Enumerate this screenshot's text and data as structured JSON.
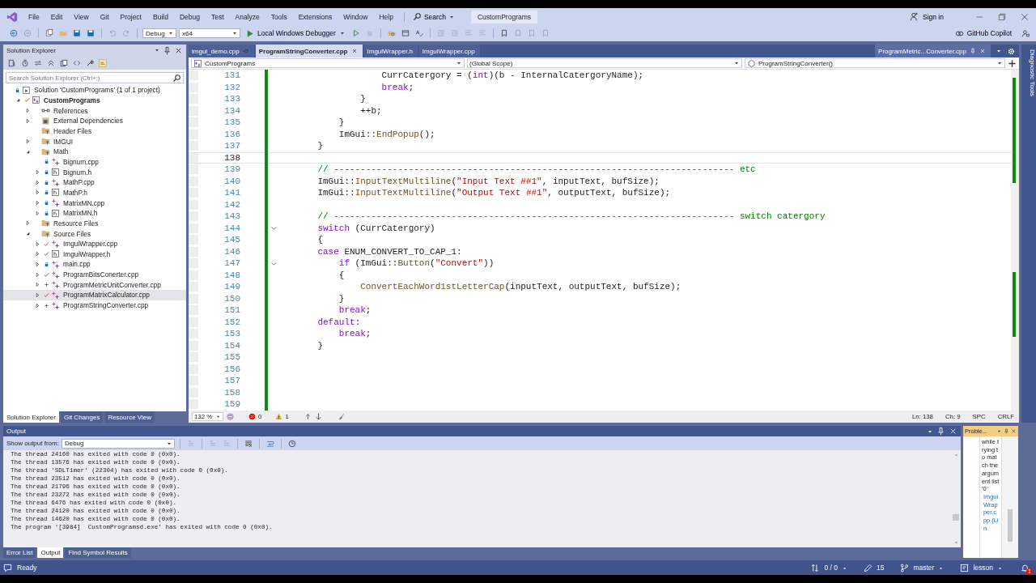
{
  "window": {
    "title": "CustomPrograms",
    "sign_in": "Sign in"
  },
  "menu": {
    "items": [
      "File",
      "Edit",
      "View",
      "Git",
      "Project",
      "Build",
      "Debug",
      "Test",
      "Analyze",
      "Tools",
      "Extensions",
      "Window",
      "Help"
    ],
    "search": "Search"
  },
  "toolbar": {
    "configuration": "Debug",
    "platform": "x64",
    "debugger": "Local Windows Debugger",
    "copilot": "GitHub Copilot"
  },
  "solution_explorer": {
    "title": "Solution Explorer",
    "search_placeholder": "Search Solution Explorer (Ctrl+;)",
    "tree": [
      {
        "label": "Solution 'CustomPrograms' (1 of 1 project)",
        "kind": "solution",
        "locked": true,
        "modified": false,
        "added": false,
        "selected": false,
        "children": [
          {
            "label": "CustomPrograms",
            "kind": "project",
            "expanded": true,
            "locked": false,
            "modified": true,
            "added": false,
            "selected": false,
            "children": [
              {
                "label": "References",
                "kind": "references",
                "expanded": false,
                "locked": false,
                "modified": false,
                "added": false,
                "selected": false
              },
              {
                "label": "External Dependencies",
                "kind": "dependencies",
                "expanded": false,
                "locked": false,
                "modified": false,
                "added": false,
                "selected": false
              },
              {
                "label": "Header Files",
                "kind": "filter",
                "locked": false,
                "modified": false,
                "added": false,
                "selected": false
              },
              {
                "label": "IMGUI",
                "kind": "filter",
                "expanded": false,
                "locked": false,
                "modified": false,
                "added": false,
                "selected": false
              },
              {
                "label": "Math",
                "kind": "filter",
                "expanded": true,
                "locked": false,
                "modified": false,
                "added": false,
                "selected": false,
                "children": [
                  {
                    "label": "Bignum.cpp",
                    "kind": "cpp",
                    "locked": true,
                    "modified": false,
                    "added": false,
                    "selected": false
                  },
                  {
                    "label": "Bignum.h",
                    "kind": "h",
                    "expanded": false,
                    "locked": true,
                    "modified": false,
                    "added": false,
                    "selected": false
                  },
                  {
                    "label": "MathP.cpp",
                    "kind": "cpp",
                    "expanded": false,
                    "locked": true,
                    "modified": false,
                    "added": false,
                    "selected": false
                  },
                  {
                    "label": "MathP.h",
                    "kind": "h",
                    "expanded": false,
                    "locked": true,
                    "modified": false,
                    "added": false,
                    "selected": false
                  },
                  {
                    "label": "MatrixMN.cpp",
                    "kind": "cpp",
                    "expanded": false,
                    "locked": true,
                    "modified": false,
                    "added": false,
                    "selected": false
                  },
                  {
                    "label": "MatrixMN.h",
                    "kind": "h",
                    "expanded": false,
                    "locked": true,
                    "modified": false,
                    "added": false,
                    "selected": false
                  }
                ]
              },
              {
                "label": "Resource Files",
                "kind": "filter",
                "expanded": false,
                "locked": false,
                "modified": false,
                "added": false,
                "selected": false
              },
              {
                "label": "Source Files",
                "kind": "filter",
                "expanded": true,
                "locked": false,
                "modified": false,
                "added": false,
                "selected": false,
                "children": [
                  {
                    "label": "ImguiWrapper.cpp",
                    "kind": "cpp",
                    "expanded": false,
                    "locked": false,
                    "modified": true,
                    "added": false,
                    "selected": false
                  },
                  {
                    "label": "ImguiWrapper.h",
                    "kind": "h",
                    "expanded": false,
                    "locked": false,
                    "modified": true,
                    "added": false,
                    "selected": false
                  },
                  {
                    "label": "main.cpp",
                    "kind": "cpp",
                    "expanded": false,
                    "locked": true,
                    "modified": false,
                    "added": false,
                    "selected": false
                  },
                  {
                    "label": "ProgramBitsConerter.cpp",
                    "kind": "cpp",
                    "expanded": false,
                    "locked": false,
                    "modified": true,
                    "added": false,
                    "selected": false
                  },
                  {
                    "label": "ProgramMetricUnitConverter.cpp",
                    "kind": "cpp",
                    "expanded": false,
                    "locked": false,
                    "modified": false,
                    "added": true,
                    "selected": false
                  },
                  {
                    "label": "ProgramMatrixCalculator.cpp",
                    "kind": "cpp",
                    "expanded": false,
                    "locked": false,
                    "modified": true,
                    "added": false,
                    "selected": true
                  },
                  {
                    "label": "ProgramStringConverter.cpp",
                    "kind": "cpp",
                    "expanded": false,
                    "locked": false,
                    "modified": false,
                    "added": true,
                    "selected": false
                  }
                ]
              }
            ]
          }
        ]
      }
    ],
    "tabs": [
      {
        "label": "Solution Explorer",
        "selected": true
      },
      {
        "label": "Git Changes",
        "selected": false
      },
      {
        "label": "Resource View",
        "selected": false
      }
    ]
  },
  "editor": {
    "tabs": [
      {
        "label": "imgui_demo.cpp",
        "selected": false,
        "pinned": true,
        "kind": "docked"
      },
      {
        "label": "ProgramStringConverter.cpp",
        "selected": true,
        "pinned": false,
        "kind": "docked"
      },
      {
        "label": "ImguiWrapper.h",
        "selected": false,
        "pinned": false,
        "kind": "docked"
      },
      {
        "label": "ImguiWrapper.cpp",
        "selected": false,
        "pinned": false,
        "kind": "docked"
      },
      {
        "label": "ProgramMetric...Converter.cpp",
        "selected": false,
        "pinned": true,
        "kind": "overflow"
      }
    ],
    "nav": {
      "project": "CustomPrograms",
      "scope": "(Global Scope)",
      "member": "ProgramStringConverter()"
    },
    "lines": [
      {
        "number": "131",
        "current": false,
        "foldable": false,
        "tokens": [
          {
            "text": "                CurrCatergory = (",
            "kind": "txt"
          },
          {
            "text": "int",
            "kind": "kw"
          },
          {
            "text": ")(b - InternalCatergoryName);",
            "kind": "txt"
          }
        ]
      },
      {
        "number": "132",
        "current": false,
        "foldable": false,
        "tokens": [
          {
            "text": "                break",
            "kind": "kw"
          },
          {
            "text": ";",
            "kind": "txt"
          }
        ]
      },
      {
        "number": "133",
        "current": false,
        "foldable": false,
        "tokens": [
          {
            "text": "            }",
            "kind": "txt"
          }
        ]
      },
      {
        "number": "134",
        "current": false,
        "foldable": false,
        "tokens": [
          {
            "text": "            ++b;",
            "kind": "txt"
          }
        ]
      },
      {
        "number": "135",
        "current": false,
        "foldable": false,
        "tokens": [
          {
            "text": "        }",
            "kind": "txt"
          }
        ]
      },
      {
        "number": "136",
        "current": false,
        "foldable": false,
        "tokens": [
          {
            "text": "        ImGui::",
            "kind": "txt"
          },
          {
            "text": "EndPopup",
            "kind": "fn"
          },
          {
            "text": "();",
            "kind": "txt"
          }
        ]
      },
      {
        "number": "137",
        "current": false,
        "foldable": false,
        "tokens": [
          {
            "text": "    }",
            "kind": "txt"
          }
        ]
      },
      {
        "number": "138",
        "current": true,
        "foldable": false
      },
      {
        "number": "139",
        "current": false,
        "foldable": false,
        "tokens": [
          {
            "text": "    // --------------------------------------------------------------------------- etc",
            "kind": "cmt"
          }
        ]
      },
      {
        "number": "140",
        "current": false,
        "foldable": false,
        "tokens": [
          {
            "text": "    ImGui::",
            "kind": "txt"
          },
          {
            "text": "InputTextMultiline",
            "kind": "fn"
          },
          {
            "text": "(",
            "kind": "txt"
          },
          {
            "text": "\"Input Text ##1\"",
            "kind": "str"
          },
          {
            "text": ", inputText, bufSize);",
            "kind": "txt"
          }
        ]
      },
      {
        "number": "141",
        "current": false,
        "foldable": false,
        "tokens": [
          {
            "text": "    ImGui::",
            "kind": "txt"
          },
          {
            "text": "InputTextMultiline",
            "kind": "fn"
          },
          {
            "text": "(",
            "kind": "txt"
          },
          {
            "text": "\"Output Text ##1\"",
            "kind": "str"
          },
          {
            "text": ", outputText, bufSize);",
            "kind": "txt"
          }
        ]
      },
      {
        "number": "142",
        "current": false,
        "foldable": false
      },
      {
        "number": "143",
        "current": false,
        "foldable": false,
        "tokens": [
          {
            "text": "    // --------------------------------------------------------------------------- switch catergory",
            "kind": "cmt"
          }
        ]
      },
      {
        "number": "144",
        "current": false,
        "foldable": true,
        "tokens": [
          {
            "text": "    switch",
            "kind": "kw"
          },
          {
            "text": " (CurrCatergory)",
            "kind": "txt"
          }
        ]
      },
      {
        "number": "145",
        "current": false,
        "foldable": false,
        "tokens": [
          {
            "text": "    {",
            "kind": "txt"
          }
        ]
      },
      {
        "number": "146",
        "current": false,
        "foldable": false,
        "tokens": [
          {
            "text": "    case",
            "kind": "kw"
          },
          {
            "text": " ENUM_CONVERT_TO_CAP_1:",
            "kind": "txt"
          }
        ]
      },
      {
        "number": "147",
        "current": false,
        "foldable": true,
        "tokens": [
          {
            "text": "        if",
            "kind": "kw"
          },
          {
            "text": " (ImGui::",
            "kind": "txt"
          },
          {
            "text": "Button",
            "kind": "fn"
          },
          {
            "text": "(",
            "kind": "txt"
          },
          {
            "text": "\"Convert\"",
            "kind": "str"
          },
          {
            "text": "))",
            "kind": "txt"
          }
        ]
      },
      {
        "number": "148",
        "current": false,
        "foldable": false,
        "tokens": [
          {
            "text": "        {",
            "kind": "txt"
          }
        ]
      },
      {
        "number": "149",
        "current": false,
        "foldable": false,
        "tokens": [
          {
            "text": "            ConvertEachWord1stLetterCap",
            "kind": "fn"
          },
          {
            "text": "(inputText, outputText, bufSize);",
            "kind": "txt"
          }
        ]
      },
      {
        "number": "150",
        "current": false,
        "foldable": false,
        "tokens": [
          {
            "text": "        }",
            "kind": "txt"
          }
        ]
      },
      {
        "number": "151",
        "current": false,
        "foldable": false,
        "tokens": [
          {
            "text": "        break",
            "kind": "kw"
          },
          {
            "text": ";",
            "kind": "txt"
          }
        ]
      },
      {
        "number": "152",
        "current": false,
        "foldable": false,
        "tokens": [
          {
            "text": "    default",
            "kind": "kw"
          },
          {
            "text": ":",
            "kind": "txt"
          }
        ]
      },
      {
        "number": "153",
        "current": false,
        "foldable": false,
        "tokens": [
          {
            "text": "        break",
            "kind": "kw"
          },
          {
            "text": ";",
            "kind": "txt"
          }
        ]
      },
      {
        "number": "154",
        "current": false,
        "foldable": false,
        "tokens": [
          {
            "text": "    }",
            "kind": "txt"
          }
        ]
      },
      {
        "number": "155",
        "current": false,
        "foldable": false
      },
      {
        "number": "156",
        "current": false,
        "foldable": false
      },
      {
        "number": "157",
        "current": false,
        "foldable": false
      },
      {
        "number": "158",
        "current": false,
        "foldable": false
      },
      {
        "number": "159",
        "current": false,
        "foldable": false
      }
    ],
    "status": {
      "zoom": "132 %",
      "errors": "0",
      "warnings": "1",
      "line": "Ln: 138",
      "column": "Ch: 9",
      "indent": "SPC",
      "line_ending": "CRLF"
    }
  },
  "diagnostic_tools": {
    "title": "Diagnostic Tools"
  },
  "output": {
    "title": "Output",
    "show_from_label": "Show output from:",
    "source": "Debug",
    "lines": [
      "The thread 24160 has exited with code 0 (0x0).",
      "The thread 13576 has exited with code 0 (0x0).",
      "The thread 'SDLTimer' (22304) has exited with code 0 (0x0).",
      "The thread 23512 has exited with code 0 (0x0).",
      "The thread 21796 has exited with code 0 (0x0).",
      "The thread 23272 has exited with code 0 (0x0).",
      "The thread 6476 has exited with code 0 (0x0).",
      "The thread 24120 has exited with code 0 (0x0).",
      "The thread 14620 has exited with code 0 (0x0).",
      "The program '[3984]  CustomProgramsd.exe' has exited with code 0 (0x0)."
    ],
    "tabs": [
      {
        "label": "Error List",
        "selected": false
      },
      {
        "label": "Output",
        "selected": true
      },
      {
        "label": "Find Symbol Results",
        "selected": false
      }
    ]
  },
  "problem_panel": {
    "title": "Proble...",
    "message": "while trying to match the argument list '0'",
    "link": "ImguiWrapper.cpp (Lin"
  },
  "status_bar": {
    "state": "Ready",
    "sync": "0 / 0",
    "changes": "15",
    "branch": "master",
    "repository": "lesson",
    "notifications": "1"
  }
}
